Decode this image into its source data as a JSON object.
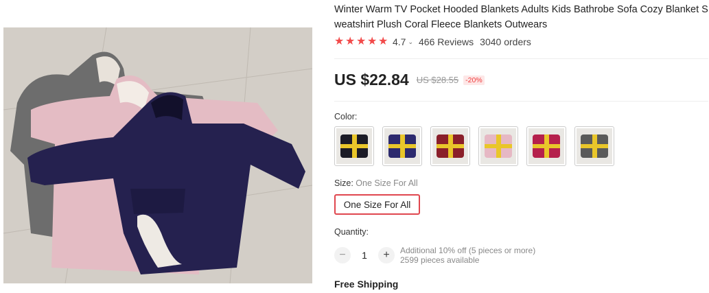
{
  "product": {
    "title": "Winter Warm TV Pocket Hooded Blankets Adults Kids Bathrobe Sofa Cozy Blanket Sweatshirt Plush Coral Fleece Blankets Outwears",
    "rating": "4.7",
    "rating_caret": "⌄",
    "reviews": "466 Reviews",
    "orders": "3040 orders",
    "star_color": "#f24b4b",
    "stars": 5
  },
  "price": {
    "current": "US $22.84",
    "original": "US $28.55",
    "discount": "-20%",
    "accent_color": "#f03a3a"
  },
  "color": {
    "label": "Color:",
    "options": [
      {
        "name": "black",
        "body": "#1b1b26",
        "stripe": "#e9c62a"
      },
      {
        "name": "navy",
        "body": "#2d2a6e",
        "stripe": "#e9c62a"
      },
      {
        "name": "burgundy",
        "body": "#8a1f2a",
        "stripe": "#e9c62a"
      },
      {
        "name": "pink",
        "body": "#e6b8c4",
        "stripe": "#e9c62a"
      },
      {
        "name": "rose-red",
        "body": "#b5204c",
        "stripe": "#e9c62a"
      },
      {
        "name": "grey",
        "body": "#5a5a5a",
        "stripe": "#e9c62a"
      }
    ]
  },
  "size": {
    "label": "Size:",
    "selected": "One Size For All",
    "option": "One Size For All",
    "selected_border": "#e0464e"
  },
  "quantity": {
    "label": "Quantity:",
    "minus": "−",
    "value": "1",
    "plus": "+",
    "offer": "Additional 10% off (5 pieces or more)",
    "available": "2599 pieces available"
  },
  "shipping": {
    "label": "Free Shipping"
  }
}
